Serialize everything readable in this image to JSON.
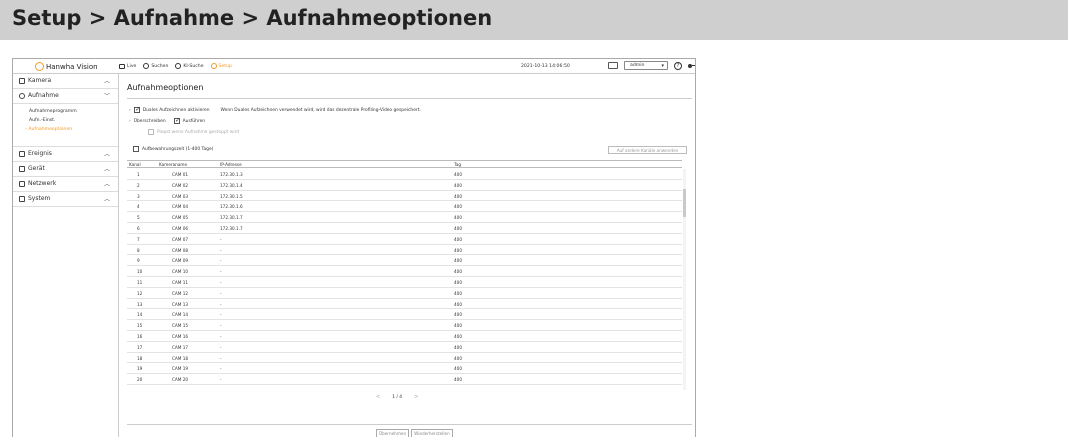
{
  "banner": {
    "title": "Setup > Aufnahme > Aufnahmeoptionen"
  },
  "topbar": {
    "brand": "Hanwha Vision",
    "nav": [
      {
        "label": "Live",
        "icon": "monitor-icon"
      },
      {
        "label": "Suchen",
        "icon": "search-icon"
      },
      {
        "label": "KI-Suche",
        "icon": "ai-search-icon"
      },
      {
        "label": "Setup",
        "icon": "gear-icon"
      }
    ],
    "datetime": "2021-10-13 14:06:50",
    "user": "admin",
    "help": "?"
  },
  "sidebar": {
    "kamera": "Kamera",
    "aufnahme": "Aufnahme",
    "aufnahme_sub": [
      "Aufnahmeprogramm",
      "Aufn.-Einst.",
      "Aufnahmeoptionen"
    ],
    "ereignis": "Ereignis",
    "geraet": "Gerät",
    "netzwerk": "Netzwerk",
    "system": "System"
  },
  "main": {
    "title": "Aufnahmeoptionen",
    "dual_label": "Duales Aufzeichnen aktivieren",
    "dual_info": "Wenn Duales Aufzeichnen verwendet wird, wird das dezentrale Profiling-Video gespeichert.",
    "overwrite_label": "Überschreiben",
    "overwrite_value": "Ausführen",
    "beep_label": "Piepst wenn Aufnahme gestoppt wird",
    "retention_label": "Aufbewahrungszeit (1-400 Tage)",
    "apply_others": "Auf andere Kanäle anwenden",
    "columns": [
      "Kanal",
      "Kameraname",
      "IP-Adresse",
      "Tag"
    ],
    "rows": [
      [
        "1",
        "CAM 01",
        "172.30.1.3",
        "400"
      ],
      [
        "2",
        "CAM 02",
        "172.30.1.4",
        "400"
      ],
      [
        "3",
        "CAM 03",
        "172.30.1.5",
        "400"
      ],
      [
        "4",
        "CAM 04",
        "172.30.1.6",
        "400"
      ],
      [
        "5",
        "CAM 05",
        "172.30.1.7",
        "400"
      ],
      [
        "6",
        "CAM 06",
        "172.30.1.7",
        "400"
      ],
      [
        "7",
        "CAM 07",
        "-",
        "400"
      ],
      [
        "8",
        "CAM 08",
        "-",
        "400"
      ],
      [
        "9",
        "CAM 09",
        "-",
        "400"
      ],
      [
        "10",
        "CAM 10",
        "-",
        "400"
      ],
      [
        "11",
        "CAM 11",
        "-",
        "400"
      ],
      [
        "12",
        "CAM 12",
        "-",
        "400"
      ],
      [
        "13",
        "CAM 13",
        "-",
        "400"
      ],
      [
        "14",
        "CAM 14",
        "-",
        "400"
      ],
      [
        "15",
        "CAM 15",
        "-",
        "400"
      ],
      [
        "16",
        "CAM 16",
        "-",
        "400"
      ],
      [
        "17",
        "CAM 17",
        "-",
        "400"
      ],
      [
        "18",
        "CAM 18",
        "-",
        "400"
      ],
      [
        "19",
        "CAM 19",
        "-",
        "400"
      ],
      [
        "20",
        "CAM 20",
        "-",
        "400"
      ]
    ],
    "pager": {
      "prev": "<",
      "current": "1 / 4",
      "next": ">"
    },
    "apply_button": "Übernehmen",
    "restore_button": "Wiederherstellen"
  }
}
